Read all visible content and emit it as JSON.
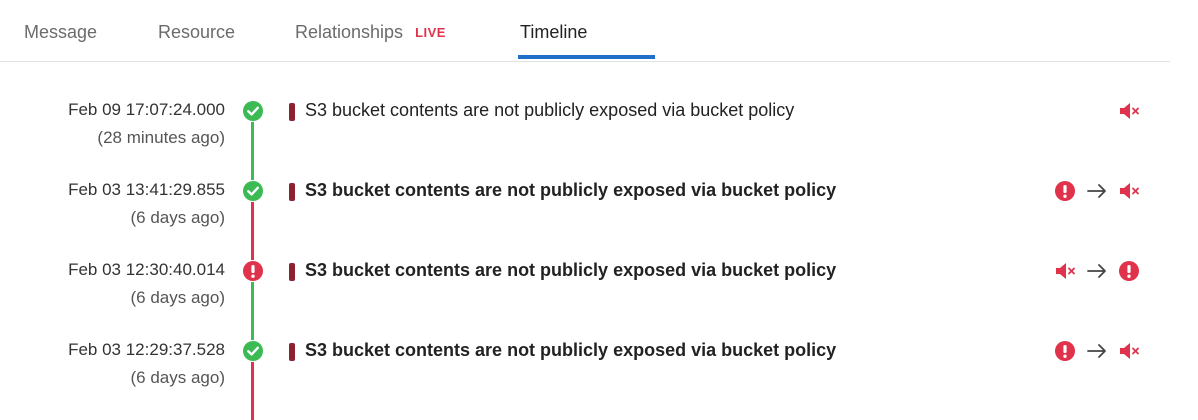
{
  "tabs": {
    "items": [
      {
        "label": "Message"
      },
      {
        "label": "Resource"
      },
      {
        "label": "Relationships",
        "badge": "LIVE"
      },
      {
        "label": "Timeline"
      }
    ],
    "active": "Timeline"
  },
  "colors": {
    "accent": "#1f6ec8",
    "pass": "#3cba54",
    "fail": "#e0324b",
    "severity": "#8b2030"
  },
  "timeline": [
    {
      "date": "Feb 09 17:07:24.000",
      "relative": "(28 minutes ago)",
      "status_icon": "check-circle-icon",
      "title": "S3 bucket contents are not publicly exposed via bucket policy",
      "change": [
        "muted-icon"
      ]
    },
    {
      "date": "Feb 03 13:41:29.855",
      "relative": "(6 days ago)",
      "status_icon": "check-circle-icon",
      "title": "S3 bucket contents are not publicly exposed via bucket policy",
      "change": [
        "alert-icon",
        "arrow-right-icon",
        "muted-icon"
      ]
    },
    {
      "date": "Feb 03 12:30:40.014",
      "relative": "(6 days ago)",
      "status_icon": "alert-circle-icon",
      "title": "S3 bucket contents are not publicly exposed via bucket policy",
      "change": [
        "muted-icon",
        "arrow-right-icon",
        "alert-icon"
      ]
    },
    {
      "date": "Feb 03 12:29:37.528",
      "relative": "(6 days ago)",
      "status_icon": "check-circle-icon",
      "title": "S3 bucket contents are not publicly exposed via bucket policy",
      "change": [
        "alert-icon",
        "arrow-right-icon",
        "muted-icon"
      ]
    }
  ]
}
